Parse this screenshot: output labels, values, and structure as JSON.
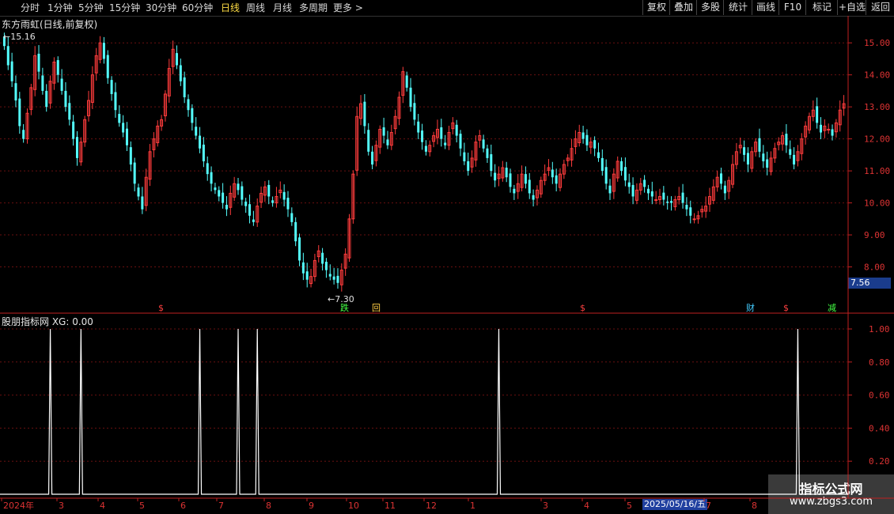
{
  "toolbar": {
    "periods": [
      "分时",
      "1分钟",
      "5分钟",
      "15分钟",
      "30分钟",
      "60分钟",
      "日线",
      "周线",
      "月线",
      "多周期",
      "更多 >"
    ],
    "active_period": "日线",
    "buttons": [
      "复权",
      "叠加",
      "多股",
      "统计",
      "画线",
      "F10",
      "标记",
      "+自选",
      "返回"
    ]
  },
  "main_chart": {
    "title": "东方雨虹(日线,前复权)",
    "high_label": "15.16",
    "low_label": "7.30",
    "current_price": "7.56",
    "y_axis": [
      "15.00",
      "14.00",
      "13.00",
      "12.00",
      "11.00",
      "10.00",
      "9.00",
      "8.00"
    ],
    "markers": [
      {
        "text": "$",
        "color": "#ff4040"
      },
      {
        "text": "跌",
        "color": "#44ff44"
      },
      {
        "text": "回",
        "color": "#ffcc44"
      },
      {
        "text": "$",
        "color": "#ff4040"
      },
      {
        "text": "财",
        "color": "#44ccff"
      },
      {
        "text": "$",
        "color": "#ff4040"
      },
      {
        "text": "减",
        "color": "#44ff44"
      }
    ]
  },
  "indicator": {
    "title": "股朋指标网 XG: 0.00",
    "y_axis": [
      "1.00",
      "0.80",
      "0.60",
      "0.40",
      "0.20"
    ]
  },
  "x_axis": [
    "2024年",
    "3",
    "4",
    "5",
    "6",
    "7",
    "8",
    "9",
    "10",
    "11",
    "12",
    "1",
    "3",
    "4",
    "5",
    "7",
    "8"
  ],
  "date_tag": "2025/05/16/五",
  "watermark": {
    "title": "指标公式网",
    "url": "www.zbgs3.com"
  },
  "colors": {
    "up": "#ff3c3c",
    "down": "#54ffff",
    "axis": "#c02020",
    "grid": "#6a1010",
    "accent": "#ffdd44"
  },
  "chart_data": {
    "type": "candlestick",
    "title": "东方雨虹(日线,前复权)",
    "ylim": [
      7,
      15.4
    ],
    "closes": [
      14.9,
      14.3,
      13.8,
      13.2,
      12.4,
      12.0,
      12.8,
      13.6,
      14.6,
      14.1,
      13.5,
      13.0,
      13.8,
      14.4,
      14.0,
      13.5,
      13.0,
      12.6,
      12.0,
      11.4,
      11.9,
      12.6,
      13.2,
      14.0,
      14.6,
      15.0,
      14.5,
      13.9,
      13.4,
      12.9,
      12.5,
      12.2,
      11.8,
      11.2,
      10.6,
      10.2,
      9.8,
      10.8,
      11.6,
      12.0,
      12.4,
      12.6,
      13.4,
      14.2,
      14.8,
      14.3,
      13.8,
      13.3,
      12.9,
      12.5,
      12.1,
      11.7,
      11.3,
      10.9,
      10.6,
      10.4,
      10.2,
      10.0,
      9.8,
      10.3,
      10.6,
      10.4,
      10.1,
      9.9,
      9.6,
      9.4,
      9.9,
      10.3,
      10.5,
      10.2,
      10.0,
      10.2,
      10.4,
      10.1,
      9.8,
      9.4,
      8.8,
      8.2,
      7.8,
      7.6,
      7.7,
      8.2,
      8.5,
      8.1,
      7.9,
      7.7,
      7.6,
      7.5,
      7.9,
      8.4,
      9.5,
      10.9,
      12.7,
      13.1,
      12.4,
      11.6,
      11.2,
      11.8,
      12.3,
      12.1,
      11.8,
      12.2,
      12.7,
      13.3,
      14.1,
      13.6,
      13.0,
      12.6,
      12.2,
      11.9,
      11.6,
      11.8,
      12.1,
      12.3,
      12.0,
      11.8,
      12.2,
      12.5,
      12.1,
      11.7,
      11.3,
      11.0,
      11.4,
      11.9,
      12.1,
      11.7,
      11.4,
      11.0,
      10.7,
      10.9,
      11.1,
      10.8,
      10.5,
      10.3,
      10.6,
      10.9,
      10.6,
      10.3,
      10.1,
      10.4,
      10.7,
      10.9,
      11.1,
      10.8,
      10.6,
      10.9,
      11.2,
      11.4,
      11.7,
      12.0,
      12.2,
      12.0,
      11.8,
      11.9,
      11.7,
      11.4,
      11.0,
      10.6,
      10.3,
      10.9,
      11.3,
      11.0,
      10.7,
      10.5,
      10.2,
      10.4,
      10.6,
      10.5,
      10.3,
      10.2,
      10.1,
      10.2,
      10.1,
      10.0,
      10.0,
      10.1,
      10.2,
      10.0,
      9.8,
      9.6,
      9.5,
      9.6,
      9.8,
      9.9,
      10.2,
      10.5,
      10.8,
      10.6,
      10.3,
      10.7,
      11.2,
      11.6,
      11.8,
      11.5,
      11.2,
      11.6,
      11.9,
      11.6,
      11.3,
      11.1,
      11.4,
      11.7,
      11.9,
      12.1,
      11.8,
      11.5,
      11.2,
      11.6,
      12.0,
      12.4,
      12.7,
      12.9,
      12.5,
      12.2,
      12.4,
      12.3,
      12.1,
      12.5,
      12.9,
      13.1
    ],
    "xg_signals": [
      {
        "index": 12,
        "value": 1.0
      },
      {
        "index": 20,
        "value": 1.0
      },
      {
        "index": 51,
        "value": 1.0
      },
      {
        "index": 61,
        "value": 1.0
      },
      {
        "index": 66,
        "value": 1.0
      },
      {
        "index": 129,
        "value": 1.0
      },
      {
        "index": 207,
        "value": 1.0
      }
    ],
    "indicator_ylim": [
      0,
      1.0
    ],
    "grid": true
  }
}
